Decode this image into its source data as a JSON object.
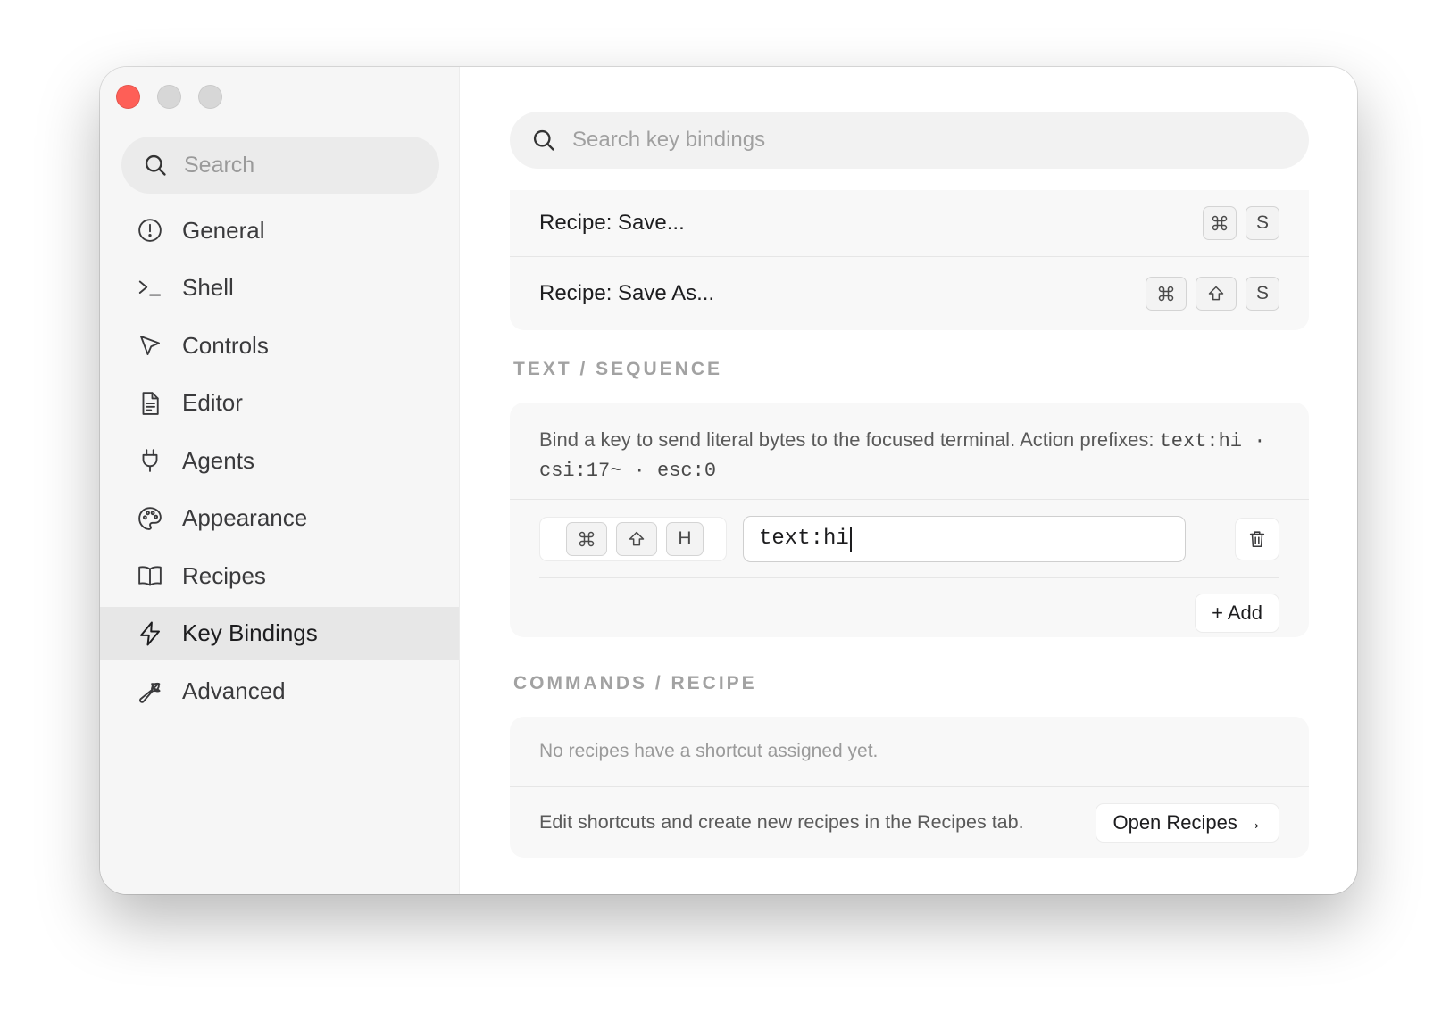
{
  "window": {
    "traffic_lights": [
      "close",
      "minimize",
      "maximize"
    ]
  },
  "sidebar": {
    "search_placeholder": "Search",
    "items": [
      {
        "label": "General",
        "icon": "info-circle-icon"
      },
      {
        "label": "Shell",
        "icon": "terminal-prompt-icon"
      },
      {
        "label": "Controls",
        "icon": "cursor-arrow-icon"
      },
      {
        "label": "Editor",
        "icon": "document-icon"
      },
      {
        "label": "Agents",
        "icon": "plug-icon"
      },
      {
        "label": "Appearance",
        "icon": "palette-icon"
      },
      {
        "label": "Recipes",
        "icon": "book-icon"
      },
      {
        "label": "Key Bindings",
        "icon": "lightning-icon",
        "active": true
      },
      {
        "label": "Advanced",
        "icon": "wrench-icon"
      }
    ]
  },
  "main": {
    "search_placeholder": "Search key bindings",
    "recipe_bindings": [
      {
        "title": "Recipe: Save...",
        "keys": [
          "⌘",
          "S"
        ]
      },
      {
        "title": "Recipe: Save As...",
        "keys": [
          "⌘",
          "⇧",
          "S"
        ]
      }
    ],
    "text_sequence": {
      "label": "TEXT / SEQUENCE",
      "desc_prefix": "Bind a key to send literal bytes to the focused terminal. Action prefixes: ",
      "prefix_examples": [
        "text:hi",
        "csi:17~",
        "esc:0"
      ],
      "separator": " · ",
      "binding": {
        "keys": [
          "⌘",
          "⇧",
          "H"
        ],
        "action": "text:hi"
      },
      "add_label": "+ Add"
    },
    "commands_recipe": {
      "label": "COMMANDS / RECIPE",
      "empty": "No recipes have a shortcut assigned yet.",
      "hint": "Edit shortcuts and create new recipes in the Recipes tab.",
      "open_label": "Open Recipes →"
    }
  },
  "colors": {
    "close": "#fe5f57",
    "sidebar_bg": "#f6f6f6",
    "active_item_bg": "#e7e7e7",
    "card_bg": "#f8f8f8",
    "section_label": "#a2a2a2"
  }
}
